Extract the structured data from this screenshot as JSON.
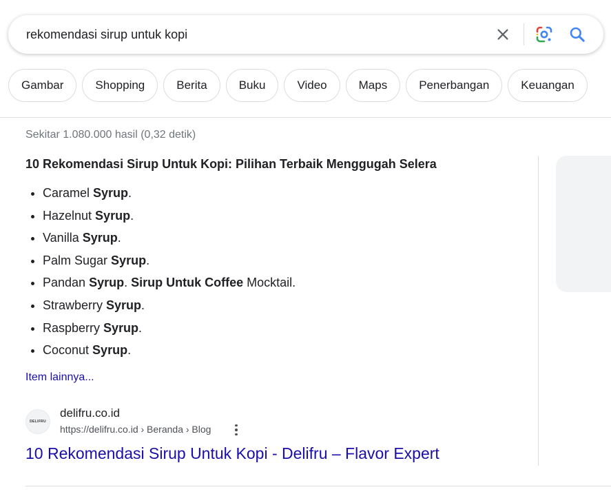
{
  "search": {
    "query": "rekomendasi sirup untuk kopi"
  },
  "chips": [
    {
      "label": "Gambar"
    },
    {
      "label": "Shopping"
    },
    {
      "label": "Berita"
    },
    {
      "label": "Buku"
    },
    {
      "label": "Video"
    },
    {
      "label": "Maps"
    },
    {
      "label": "Penerbangan"
    },
    {
      "label": "Keuangan"
    }
  ],
  "results_stats": "Sekitar 1.080.000 hasil (0,32 detik)",
  "snippet": {
    "title": "10 Rekomendasi Sirup Untuk Kopi: Pilihan Terbaik Menggugah Selera",
    "items": [
      {
        "pre": "Caramel ",
        "bold": "Syrup",
        "post": "."
      },
      {
        "pre": "Hazelnut ",
        "bold": "Syrup",
        "post": "."
      },
      {
        "pre": "Vanilla ",
        "bold": "Syrup",
        "post": "."
      },
      {
        "pre": "Palm Sugar ",
        "bold": "Syrup",
        "post": "."
      },
      {
        "pre": "Pandan ",
        "bold": "Syrup",
        "mid": ". ",
        "bold2": "Sirup Untuk Coffee",
        "post": " Mocktail."
      },
      {
        "pre": "Strawberry ",
        "bold": "Syrup",
        "post": "."
      },
      {
        "pre": "Raspberry ",
        "bold": "Syrup",
        "post": "."
      },
      {
        "pre": "Coconut ",
        "bold": "Syrup",
        "post": "."
      }
    ],
    "more_link": "Item lainnya..."
  },
  "result": {
    "favicon_text": "DELIFRU",
    "site_name": "delifru.co.id",
    "url": "https://delifru.co.id › Beranda › Blog",
    "title": "10 Rekomendasi Sirup Untuk Kopi - Delifru – Flavor Expert"
  },
  "colors": {
    "link": "#1a0dab",
    "secondary_text": "#70757a",
    "border": "#dadce0"
  },
  "icons": {
    "clear": "close-icon",
    "lens": "google-lens-icon",
    "search": "search-icon",
    "more": "more-vertical-icon"
  }
}
